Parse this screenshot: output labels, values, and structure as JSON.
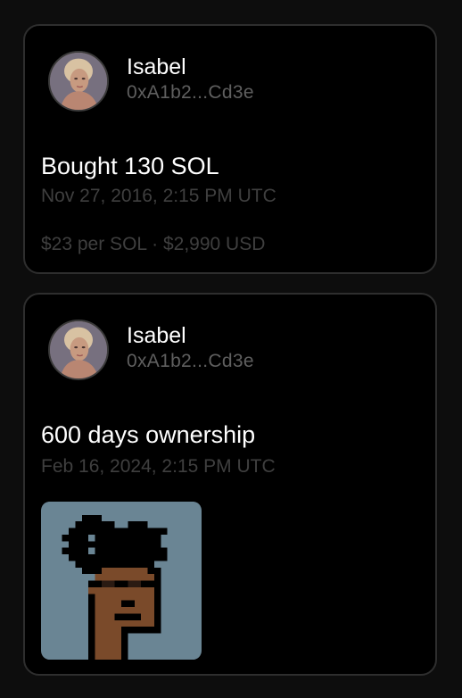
{
  "activity": [
    {
      "user": {
        "name": "Isabel",
        "address": "0xA1b2...Cd3e"
      },
      "title": "Bought 130 SOL",
      "timestamp": "Nov 27, 2016, 2:15 PM UTC",
      "price": "$23 per SOL · $2,990 USD"
    },
    {
      "user": {
        "name": "Isabel",
        "address": "0xA1b2...Cd3e"
      },
      "title": "600 days ownership",
      "timestamp": "Feb 16, 2024, 2:15 PM UTC",
      "nft": {
        "icon": "pixel-punk-icon",
        "background_color": "#6a8594"
      }
    }
  ],
  "colors": {
    "card_background": "#000000",
    "card_border": "#2e2e2e",
    "primary_text": "#ffffff",
    "secondary_text": "#5f5f5f",
    "muted_text": "#3f3f3f"
  }
}
